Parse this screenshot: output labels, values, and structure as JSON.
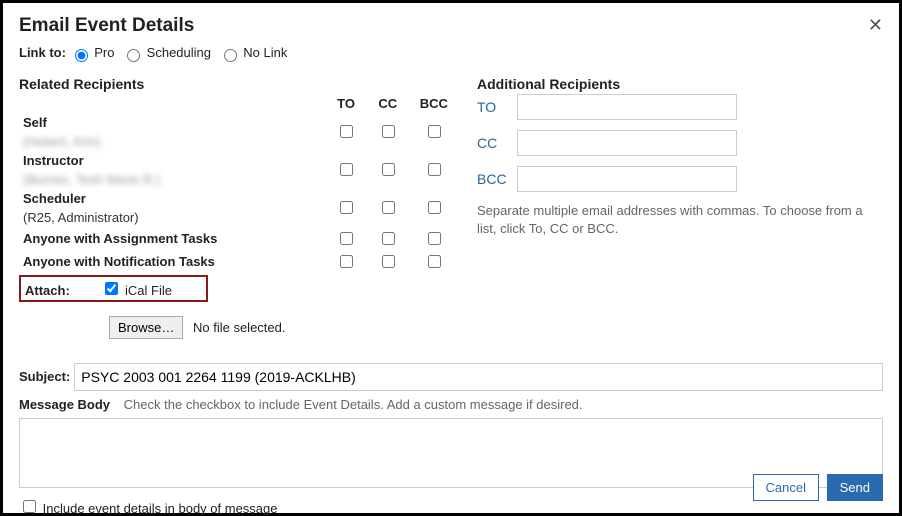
{
  "dialog": {
    "title": "Email Event Details",
    "close_icon": "✕"
  },
  "linkto": {
    "label": "Link to:",
    "options": [
      {
        "label": "Pro",
        "checked": true
      },
      {
        "label": "Scheduling",
        "checked": false
      },
      {
        "label": "No Link",
        "checked": false
      }
    ]
  },
  "related": {
    "heading": "Related Recipients",
    "cols": {
      "to": "TO",
      "cc": "CC",
      "bcc": "BCC"
    },
    "rows": [
      {
        "role": "Self",
        "sub": "(Hubert, Kim)",
        "blur": true
      },
      {
        "role": "Instructor",
        "sub": "(Burnes, Tesh Marie R.)",
        "blur": true
      },
      {
        "role": "Scheduler",
        "sub": "(R25, Administrator)",
        "blur": false
      },
      {
        "role": "Anyone with Assignment Tasks",
        "sub": "",
        "blur": false
      },
      {
        "role": "Anyone with Notification Tasks",
        "sub": "",
        "blur": false
      }
    ]
  },
  "attach": {
    "label": "Attach:",
    "ical_label": "iCal File",
    "ical_checked": true,
    "browse_label": "Browse…",
    "nofile": "No file selected."
  },
  "additional": {
    "heading": "Additional Recipients",
    "to_label": "TO",
    "cc_label": "CC",
    "bcc_label": "BCC",
    "help": "Separate multiple email addresses with commas. To choose from a list, click To, CC or BCC."
  },
  "subject": {
    "label": "Subject:",
    "value": "PSYC 2003 001 2264 1199 (2019-ACKLHB)"
  },
  "body": {
    "label": "Message Body",
    "hint": "Check the checkbox to include Event Details. Add a custom message if desired.",
    "value": ""
  },
  "include": {
    "label": "Include event details in body of message",
    "checked": false
  },
  "footer": {
    "cancel": "Cancel",
    "send": "Send"
  }
}
